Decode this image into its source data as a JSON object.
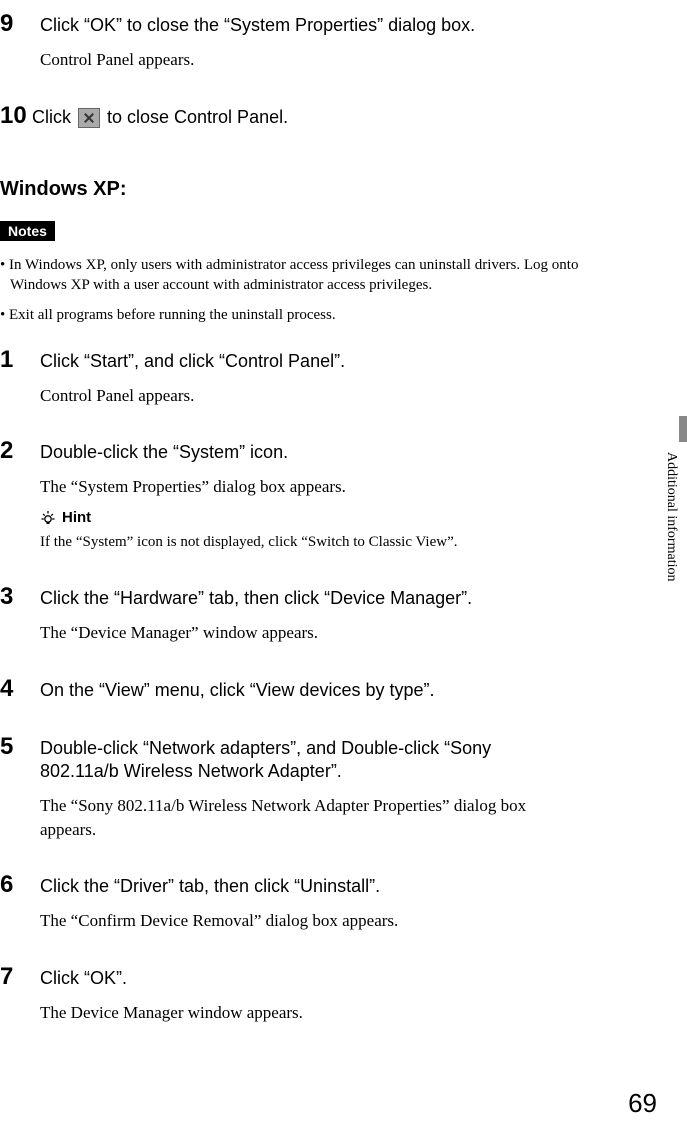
{
  "top_steps": {
    "s9": {
      "num": "9",
      "instruction": "Click “OK” to close the “System Properties” dialog box.",
      "result": "Control Panel appears."
    },
    "s10": {
      "num": "10",
      "instruction_before": "Click ",
      "instruction_after": " to close Control Panel."
    }
  },
  "section_heading": "Windows XP:",
  "notes_label": "Notes",
  "notes": {
    "n1": "•  In Windows XP, only users with administrator access privileges can uninstall drivers. Log onto Windows XP with a user account with administrator access privileges.",
    "n2": "•  Exit all programs before running the uninstall process."
  },
  "steps": {
    "s1": {
      "num": "1",
      "instruction": "Click “Start”, and click “Control Panel”.",
      "result": "Control Panel appears."
    },
    "s2": {
      "num": "2",
      "instruction": "Double-click the “System” icon.",
      "result": "The “System Properties” dialog box appears.",
      "hint_label": "Hint",
      "hint_text": "If the “System” icon is not displayed, click “Switch to Classic View”."
    },
    "s3": {
      "num": "3",
      "instruction": "Click the “Hardware” tab, then click “Device Manager”.",
      "result": "The “Device Manager” window appears."
    },
    "s4": {
      "num": "4",
      "instruction": "On the “View” menu, click “View devices by type”."
    },
    "s5": {
      "num": "5",
      "instruction": "Double-click “Network adapters”, and Double-click “Sony 802.11a/b Wireless Network Adapter”.",
      "result": "The “Sony 802.11a/b Wireless Network Adapter Properties” dialog box appears."
    },
    "s6": {
      "num": "6",
      "instruction": "Click the “Driver” tab, then click “Uninstall”.",
      "result": "The “Confirm Device Removal” dialog box appears."
    },
    "s7": {
      "num": "7",
      "instruction": "Click “OK”.",
      "result": "The Device Manager window appears."
    }
  },
  "side_tab": "Additional information",
  "page_number": "69"
}
